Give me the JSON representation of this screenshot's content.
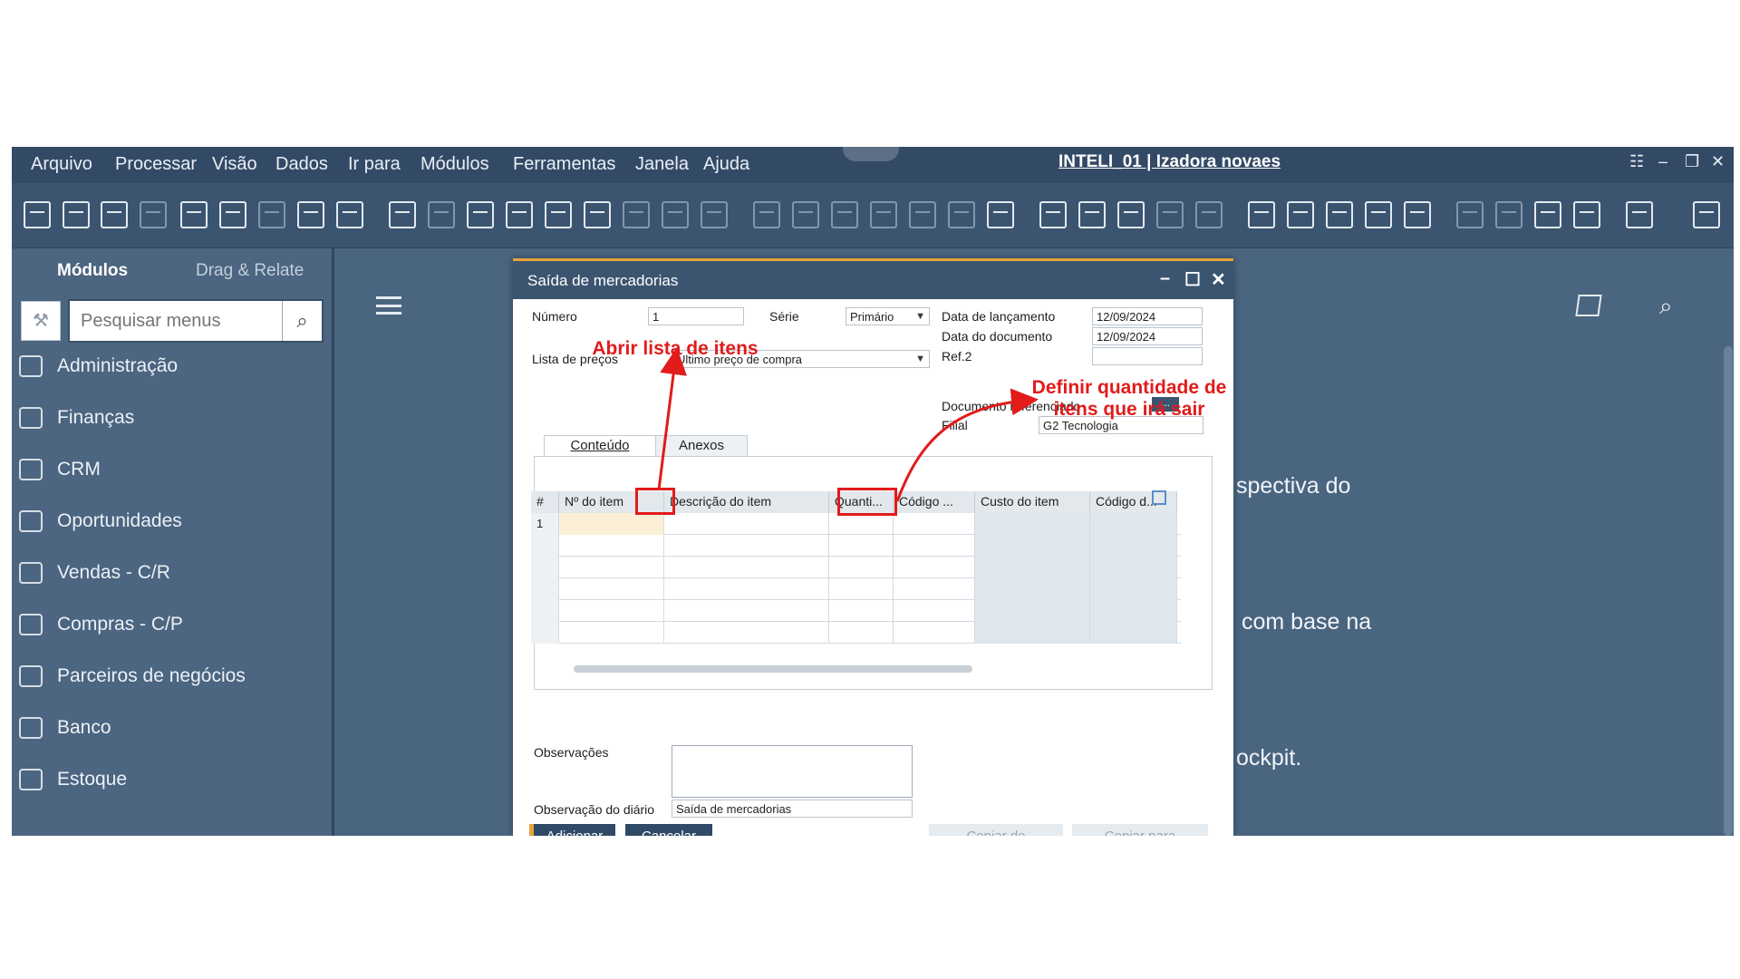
{
  "menubar": {
    "items": [
      "Arquivo",
      "Processar",
      "Visão",
      "Dados",
      "Ir para",
      "Módulos",
      "Ferramentas",
      "Janela",
      "Ajuda"
    ],
    "window_title": "INTELI_01 | Izadora novaes"
  },
  "sidebar": {
    "tabs": [
      "Módulos",
      "Drag & Relate"
    ],
    "search_placeholder": "Pesquisar menus",
    "items": [
      {
        "label": "Administração",
        "icon": "admin-icon"
      },
      {
        "label": "Finanças",
        "icon": "finance-icon"
      },
      {
        "label": "CRM",
        "icon": "crm-icon"
      },
      {
        "label": "Oportunidades",
        "icon": "opportunities-icon"
      },
      {
        "label": "Vendas - C/R",
        "icon": "sales-icon"
      },
      {
        "label": "Compras - C/P",
        "icon": "cart-icon"
      },
      {
        "label": "Parceiros de negócios",
        "icon": "partners-icon"
      },
      {
        "label": "Banco",
        "icon": "bank-icon"
      },
      {
        "label": "Estoque",
        "icon": "stock-icon"
      }
    ]
  },
  "background_text": [
    "spectiva do",
    "com base na",
    "ockpit."
  ],
  "dialog": {
    "title": "Saída de mercadorias",
    "fields": {
      "numero_label": "Número",
      "numero_value": "1",
      "serie_label": "Série",
      "serie_value": "Primário",
      "data_lancamento_label": "Data de lançamento",
      "data_lancamento_value": "12/09/2024",
      "data_documento_label": "Data do documento",
      "data_documento_value": "12/09/2024",
      "ref2_label": "Ref.2",
      "ref2_value": "",
      "lista_precos_label": "Lista de preços",
      "lista_precos_value": "Último preço de compra",
      "documento_referenciado_label": "Documento referenciado",
      "documento_referenciado_btn": "...",
      "filial_label": "Filial",
      "filial_value": "G2 Tecnologia"
    },
    "tabs": [
      "Conteúdo",
      "Anexos"
    ],
    "grid": {
      "columns": [
        "#",
        "Nº do item",
        "Descrição do item",
        "Quanti...",
        "Código ...",
        "Custo do item",
        "Código d..."
      ],
      "rows": [
        [
          "1",
          "",
          "",
          "",
          "",
          "",
          ""
        ],
        [
          "",
          "",
          "",
          "",
          "",
          "",
          ""
        ],
        [
          "",
          "",
          "",
          "",
          "",
          "",
          ""
        ],
        [
          "",
          "",
          "",
          "",
          "",
          "",
          ""
        ],
        [
          "",
          "",
          "",
          "",
          "",
          "",
          ""
        ],
        [
          "",
          "",
          "",
          "",
          "",
          "",
          ""
        ]
      ]
    },
    "observacoes_label": "Observações",
    "observacoes_value": "",
    "observacao_diario_label": "Observação do diário",
    "observacao_diario_value": "Saída de mercadorias",
    "buttons": {
      "adicionar": "Adicionar",
      "cancelar": "Cancelar",
      "copiar_de": "Copiar de",
      "copiar_para": "Copiar para"
    }
  },
  "annotations": {
    "open_item_list": "Abrir lista de itens",
    "define_quantity": "Definir quantidade de itens que irá sair"
  },
  "colors": {
    "accent": "#e8a33a",
    "annotation": "#e21b1b",
    "menubar": "#334a66",
    "dialog_titlebar": "#3b5570"
  }
}
